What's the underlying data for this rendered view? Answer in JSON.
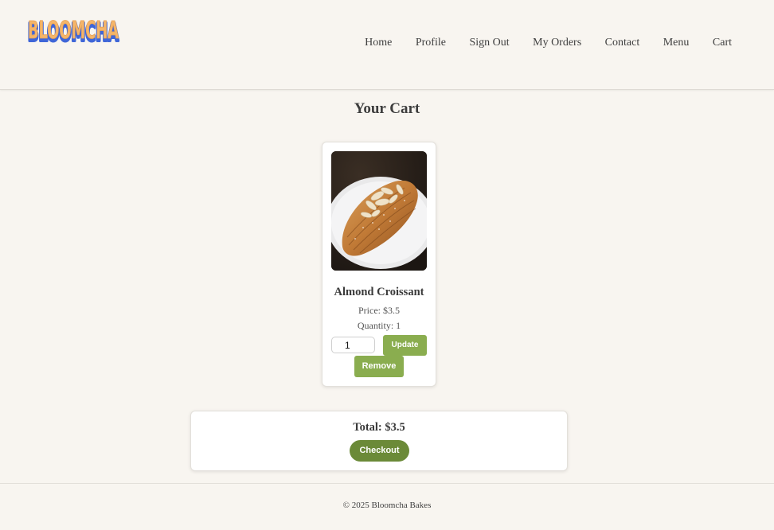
{
  "brand": {
    "logo_text": "BLOOMCHA",
    "logo_fill": "#f4b56a",
    "logo_outline": "#3f66d8"
  },
  "nav": {
    "items": [
      "Home",
      "Profile",
      "Sign Out",
      "My Orders",
      "Contact",
      "Menu",
      "Cart"
    ]
  },
  "cart": {
    "title": "Your Cart",
    "items": [
      {
        "image": "almond-croissant-photo",
        "name": "Almond Croissant",
        "price": "Price: $3.5",
        "quantity": "Quantity: 1",
        "qty_input_value": "1",
        "update_label": "Update",
        "remove_label": "Remove"
      }
    ],
    "total": "Total: $3.5",
    "checkout_label": "Checkout"
  },
  "footer": {
    "copyright": "© 2025 Bloomcha Bakes"
  },
  "colors": {
    "background": "#f8f5f0",
    "button_green": "#8aad4f",
    "checkout_green": "#6b8a38"
  }
}
